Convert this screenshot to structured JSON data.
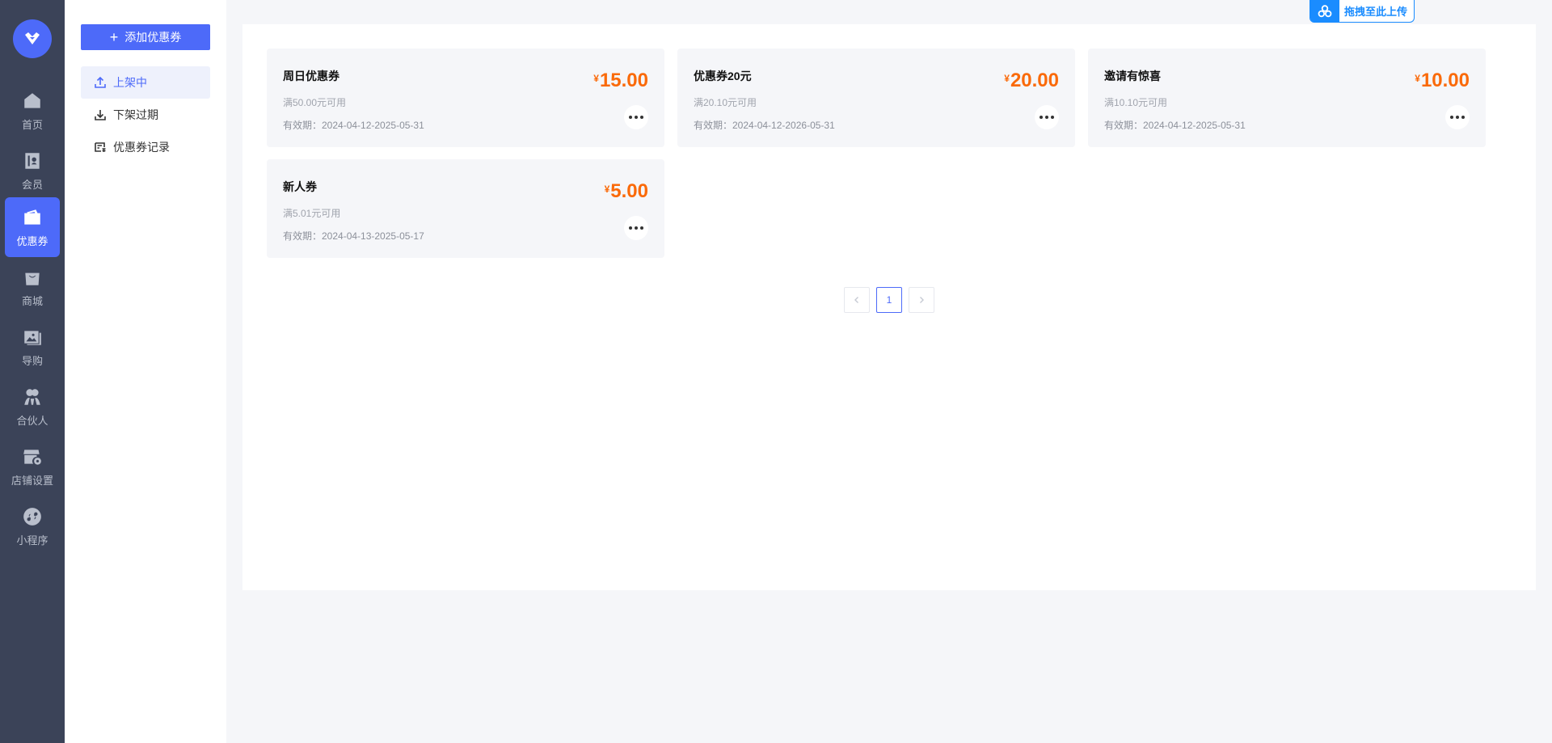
{
  "rail": {
    "items": [
      {
        "label": "首页",
        "icon": "home-icon"
      },
      {
        "label": "会员",
        "icon": "member-icon"
      },
      {
        "label": "优惠券",
        "icon": "coupon-icon",
        "active": true
      },
      {
        "label": "商城",
        "icon": "shop-bag-icon"
      },
      {
        "label": "导购",
        "icon": "image-icon"
      },
      {
        "label": "合伙人",
        "icon": "partner-icon"
      },
      {
        "label": "店铺设置",
        "icon": "store-settings-icon"
      },
      {
        "label": "小程序",
        "icon": "mini-program-icon"
      }
    ]
  },
  "subnav": {
    "add_label": "添加优惠券",
    "items": [
      {
        "label": "上架中",
        "icon": "upload-icon",
        "active": true
      },
      {
        "label": "下架过期",
        "icon": "download-icon"
      },
      {
        "label": "优惠券记录",
        "icon": "record-icon"
      }
    ]
  },
  "coupons": [
    {
      "title": "周日优惠券",
      "price": "15.00",
      "condition": "满50.00元可用",
      "validity": "有效期：2024-04-12-2025-05-31"
    },
    {
      "title": "优惠券20元",
      "price": "20.00",
      "condition": "满20.10元可用",
      "validity": "有效期：2024-04-12-2026-05-31"
    },
    {
      "title": "邀请有惊喜",
      "price": "10.00",
      "condition": "满10.10元可用",
      "validity": "有效期：2024-04-12-2025-05-31"
    },
    {
      "title": "新人券",
      "price": "5.00",
      "condition": "满5.01元可用",
      "validity": "有效期：2024-04-13-2025-05-17"
    }
  ],
  "currency_symbol": "¥",
  "pagination": {
    "current": "1"
  },
  "upload": {
    "label": "拖拽至此上传"
  },
  "colors": {
    "accent": "#4d6af9",
    "price": "#fa6a0a",
    "rail_bg": "#3b4358",
    "upload": "#1a8cff"
  }
}
